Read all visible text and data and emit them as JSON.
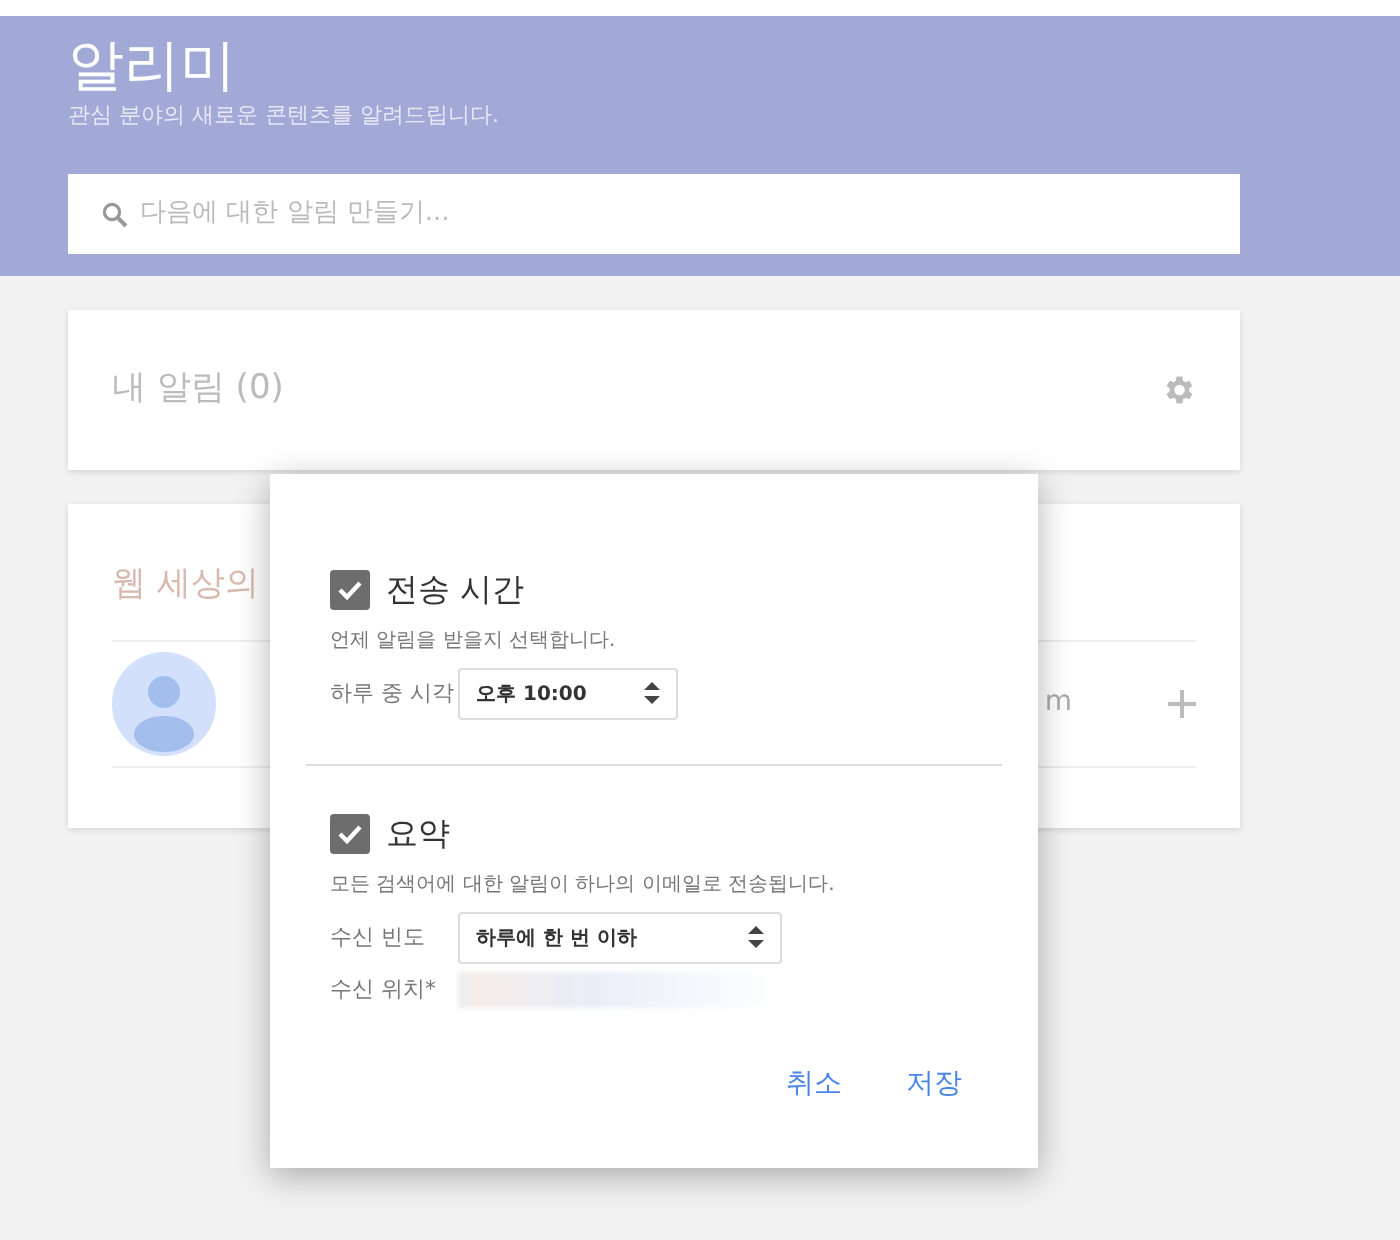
{
  "header": {
    "title": "알리미",
    "subtitle": "관심 분야의 새로운 콘텐츠를 알려드립니다.",
    "search": {
      "placeholder": "다음에 대한 알림 만들기..."
    }
  },
  "my_alerts": {
    "title": "내 알림",
    "count": "(0)"
  },
  "suggestions": {
    "title": "웹 세상의",
    "row_text": "m"
  },
  "dialog": {
    "sections": [
      {
        "title": "전송 시간",
        "checked": true,
        "description": "언제 알림을 받을지 선택합니다.",
        "fields": [
          {
            "kind": "select",
            "label": "하루 중 시각",
            "value": "오후 10:00"
          }
        ]
      },
      {
        "title": "요약",
        "checked": true,
        "description": "모든 검색어에 대한 알림이 하나의 이메일로 전송됩니다.",
        "fields": [
          {
            "kind": "select",
            "label": "수신 빈도",
            "value": "하루에 한 번 이하"
          },
          {
            "kind": "blurred",
            "label": "수신 위치*"
          }
        ]
      }
    ],
    "buttons": [
      "취소",
      "저장"
    ]
  }
}
